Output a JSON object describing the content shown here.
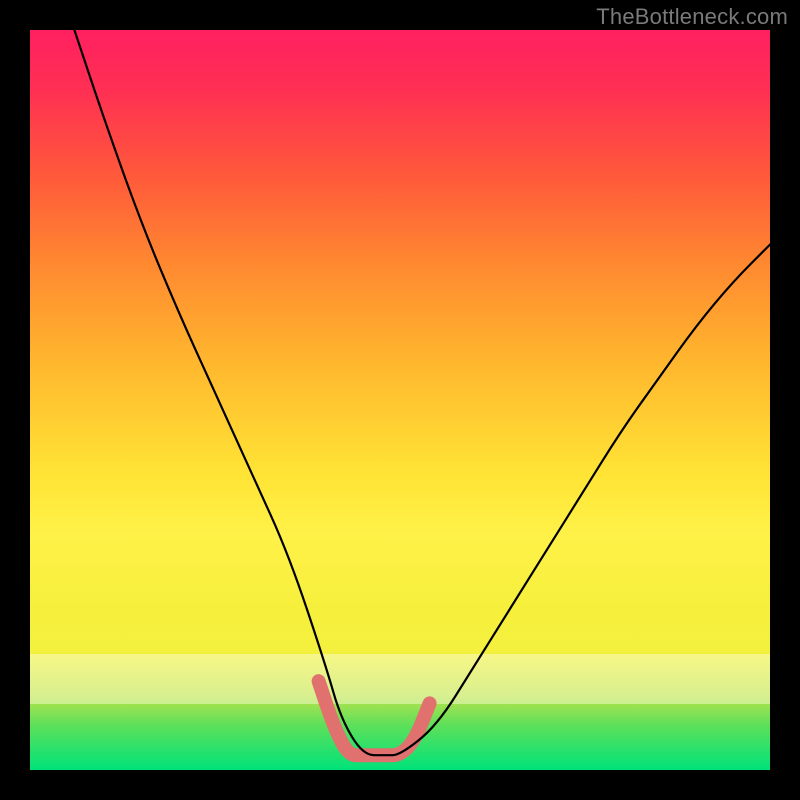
{
  "watermark": "TheBottleneck.com",
  "chart_data": {
    "type": "line",
    "title": "",
    "xlabel": "",
    "ylabel": "",
    "xlim": [
      0,
      100
    ],
    "ylim": [
      0,
      100
    ],
    "grid": false,
    "legend": false,
    "annotations": [],
    "series": [
      {
        "name": "bottleneck-curve",
        "color": "#000000",
        "x": [
          6,
          10,
          15,
          20,
          25,
          30,
          35,
          40,
          42,
          45,
          48,
          50,
          55,
          60,
          65,
          70,
          75,
          80,
          85,
          90,
          95,
          100
        ],
        "values": [
          100,
          88,
          74,
          62,
          51,
          40,
          29,
          14,
          7,
          2,
          2,
          2,
          6,
          14,
          22,
          30,
          38,
          46,
          53,
          60,
          66,
          71
        ]
      },
      {
        "name": "sweet-spot-highlight",
        "color": "#e0716f",
        "x": [
          39,
          41,
          43,
          45,
          48,
          50,
          52,
          54
        ],
        "values": [
          12,
          6,
          2,
          2,
          2,
          2,
          4,
          9
        ]
      }
    ],
    "colors": {
      "gradient_top": "#ff2060",
      "gradient_mid": "#fff148",
      "gradient_bottom": "#00e27a",
      "highlight": "#e0716f",
      "curve": "#000000",
      "frame": "#000000",
      "watermark": "#7a7a7a"
    }
  }
}
